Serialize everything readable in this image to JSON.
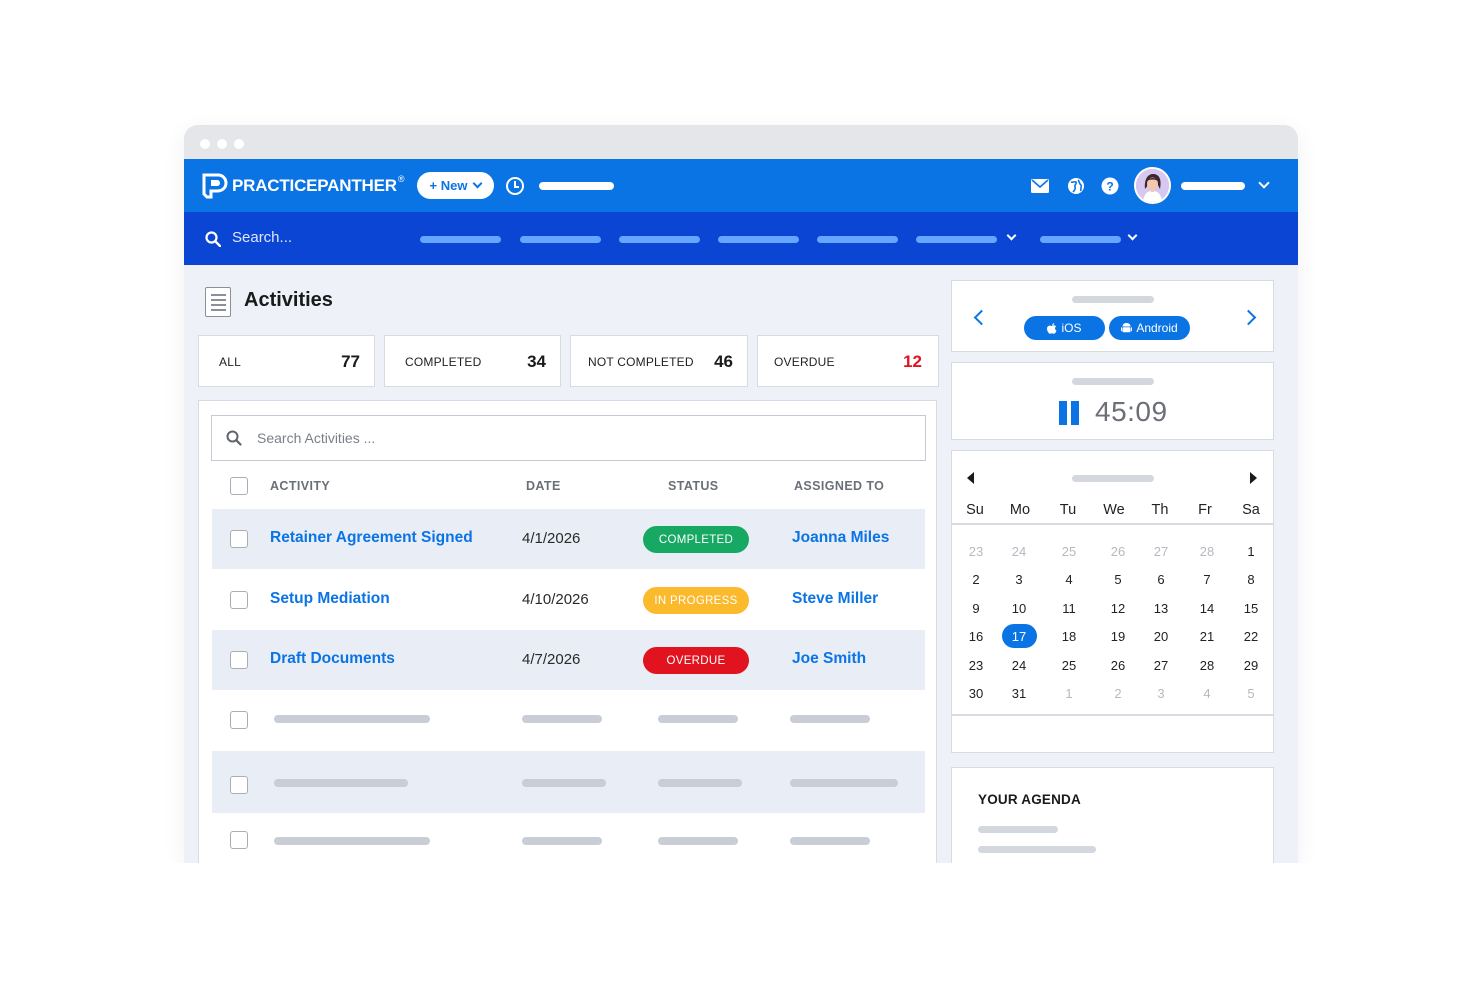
{
  "header": {
    "logo_brand": "PRACTICEPANTHER",
    "new_button": "+ New"
  },
  "nav": {
    "search_placeholder": "Search..."
  },
  "page": {
    "title": "Activities"
  },
  "stats": [
    {
      "label": "ALL",
      "value": "77",
      "color": "#1a1a1a"
    },
    {
      "label": "COMPLETED",
      "value": "34",
      "color": "#1a1a1a"
    },
    {
      "label": "NOT COMPLETED",
      "value": "46",
      "color": "#1a1a1a"
    },
    {
      "label": "OVERDUE",
      "value": "12",
      "color": "#e0131f"
    }
  ],
  "activities": {
    "search_placeholder": "Search Activities ...",
    "columns": [
      "ACTIVITY",
      "DATE",
      "STATUS",
      "ASSIGNED TO"
    ],
    "rows": [
      {
        "activity": "Retainer Agreement Signed",
        "date": "4/1/2026",
        "status": "COMPLETED",
        "status_color": "#17a864",
        "assigned_to": "Joanna Miles"
      },
      {
        "activity": "Setup Mediation",
        "date": "4/10/2026",
        "status": "IN PROGRESS",
        "status_color": "#fbb92c",
        "assigned_to": "Steve Miller"
      },
      {
        "activity": "Draft Documents",
        "date": "4/7/2026",
        "status": "OVERDUE",
        "status_color": "#e0131f",
        "assigned_to": "Joe Smith"
      }
    ]
  },
  "apps": {
    "ios": "iOS",
    "android": "Android"
  },
  "timer": {
    "value": "45:09"
  },
  "calendar": {
    "weekdays": [
      "Su",
      "Mo",
      "Tu",
      "We",
      "Th",
      "Fr",
      "Sa"
    ],
    "weeks": [
      [
        "23",
        "24",
        "25",
        "26",
        "27",
        "28",
        "1"
      ],
      [
        "2",
        "3",
        "4",
        "5",
        "6",
        "7",
        "8"
      ],
      [
        "9",
        "10",
        "11",
        "12",
        "13",
        "14",
        "15"
      ],
      [
        "16",
        "17",
        "18",
        "19",
        "20",
        "21",
        "22"
      ],
      [
        "23",
        "24",
        "25",
        "26",
        "27",
        "28",
        "29"
      ],
      [
        "30",
        "31",
        "1",
        "2",
        "3",
        "4",
        "5"
      ]
    ],
    "selected": "17"
  },
  "agenda": {
    "title": "YOUR AGENDA"
  },
  "colors": {
    "primary_blue": "#0b74e5",
    "nav_blue": "#0a45d4"
  }
}
